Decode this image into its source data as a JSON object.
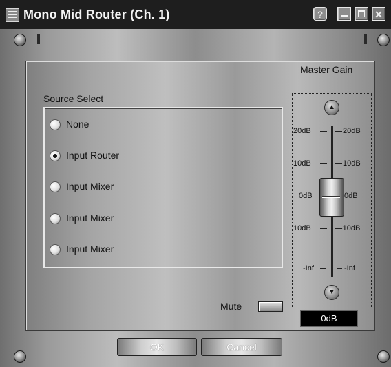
{
  "window": {
    "title": "Mono Mid Router (Ch. 1)"
  },
  "title_buttons": {
    "help": "?",
    "close": "✕"
  },
  "source_select": {
    "label": "Source Select",
    "options": [
      {
        "label": "None",
        "selected": false
      },
      {
        "label": "Input Router",
        "selected": true
      },
      {
        "label": "Input Mixer",
        "selected": false
      },
      {
        "label": "Input Mixer",
        "selected": false
      },
      {
        "label": "Input Mixer",
        "selected": false
      }
    ]
  },
  "master_gain": {
    "label": "Master Gain",
    "value_display": "0dB",
    "scale_left": [
      "20dB",
      "10dB",
      "0dB",
      "10dB",
      "-Inf"
    ],
    "scale_right": [
      "20dB",
      "10dB",
      "0dB",
      "-10dB",
      "-Inf"
    ]
  },
  "mute": {
    "label": "Mute"
  },
  "buttons": {
    "ok": "OK",
    "cancel": "Cancel"
  }
}
